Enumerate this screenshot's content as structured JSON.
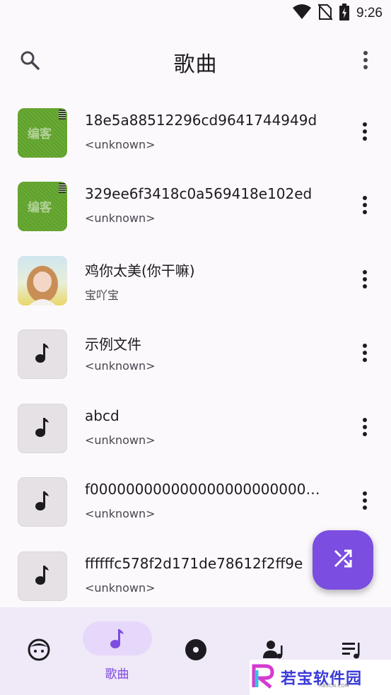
{
  "status_bar": {
    "time": "9:26"
  },
  "header": {
    "title": "歌曲"
  },
  "songs": [
    {
      "title": "18e5a88512296cd9641744949d",
      "artist": "<unknown>",
      "art_text": "编客"
    },
    {
      "title": "329ee6f3418c0a569418e102ed",
      "artist": "<unknown>",
      "art_text": "编客"
    },
    {
      "title": "鸡你太美(你干嘛)",
      "artist": "宝吖宝"
    },
    {
      "title": "示例文件",
      "artist": "<unknown>"
    },
    {
      "title": "abcd",
      "artist": "<unknown>"
    },
    {
      "title": "f000000000000000000000000000",
      "artist": "<unknown>"
    },
    {
      "title": "ffffffc578f2d171de78612f2ff9e",
      "artist": "<unknown>"
    }
  ],
  "bottom_nav": {
    "songs_label": "歌曲"
  },
  "watermark": {
    "text": "若宝软件园",
    "sub": "RBSCN.COM"
  },
  "colors": {
    "accent": "#7b4de0",
    "nav_bg": "#efe9f8",
    "pill": "#e6d8fb"
  }
}
